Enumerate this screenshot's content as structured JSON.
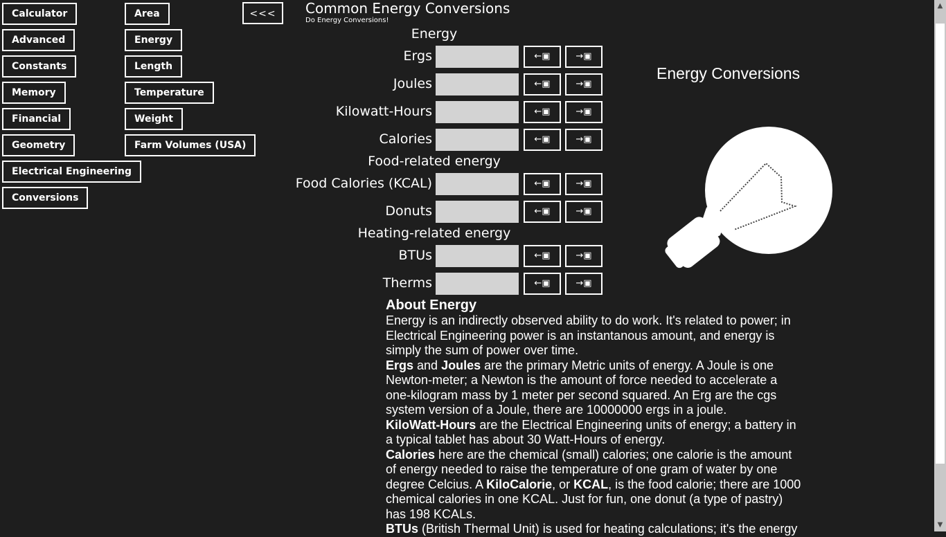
{
  "nav_col1": [
    {
      "label": "Calculator"
    },
    {
      "label": "Advanced"
    },
    {
      "label": "Constants"
    },
    {
      "label": "Memory"
    },
    {
      "label": "Financial"
    },
    {
      "label": "Geometry"
    },
    {
      "label": "Electrical Engineering"
    },
    {
      "label": "Conversions"
    }
  ],
  "nav_col2": [
    {
      "label": "Area"
    },
    {
      "label": "Energy"
    },
    {
      "label": "Length"
    },
    {
      "label": "Temperature"
    },
    {
      "label": "Weight"
    },
    {
      "label": "Farm Volumes (USA)"
    }
  ],
  "back_label": "<<<",
  "page": {
    "title": "Common Energy Conversions",
    "subtitle": "Do Energy Conversions!"
  },
  "sections": {
    "energy": "Energy",
    "food": "Food-related energy",
    "heating": "Heating-related energy"
  },
  "units": [
    {
      "label": "Ergs",
      "value": ""
    },
    {
      "label": "Joules",
      "value": ""
    },
    {
      "label": "Kilowatt-Hours",
      "value": ""
    },
    {
      "label": "Calories",
      "value": ""
    },
    {
      "label": "Food Calories (KCAL)",
      "value": ""
    },
    {
      "label": "Donuts",
      "value": ""
    },
    {
      "label": "BTUs",
      "value": ""
    },
    {
      "label": "Therms",
      "value": ""
    }
  ],
  "buttons": {
    "convert_from": "←▣",
    "convert_to": "→▣"
  },
  "side": {
    "title": "Energy Conversions",
    "image_icon": "lightbulb-icon"
  },
  "about": {
    "heading": "About Energy",
    "p1": "Energy is an indirectly observed ability to do work. It's related to power; in Electrical Engineering power is an instantanous amount, and energy is simply the sum of power over time.",
    "p2_b1": "Ergs",
    "p2_t1": " and ",
    "p2_b2": "Joules",
    "p2_t2": " are the primary Metric units of energy. A Joule is one Newton-meter; a Newton is the amount of force needed to accelerate a one-kilogram mass by 1 meter per second squared. An Erg are the cgs system version of a Joule, there are 10000000 ergs in a joule.",
    "p3_b1": "KiloWatt-Hours",
    "p3_t1": " are the Electrical Engineering units of energy; a battery in a typical tablet has about 30 Watt-Hours of energy.",
    "p4_b1": "Calories",
    "p4_t1": " here are the chemical (small) calories; one calorie is the amount of energy needed to raise the temperature of one gram of water by one degree Celcius. A ",
    "p4_b2": "KiloCalorie",
    "p4_t2": ", or ",
    "p4_b3": "KCAL",
    "p4_t3": ", is the food calorie; there are 1000 chemical calories in one KCAL. Just for fun, one donut (a type of pastry) has 198 KCALs.",
    "p5_b1": "BTUs",
    "p5_t1": " (British Thermal Unit) is used for heating calculations; it's the energy"
  },
  "colors": {
    "background": "#1e1e1e",
    "text": "#ffffff",
    "field": "#d3d3d3",
    "scrollbar": "#c8c8c8"
  }
}
